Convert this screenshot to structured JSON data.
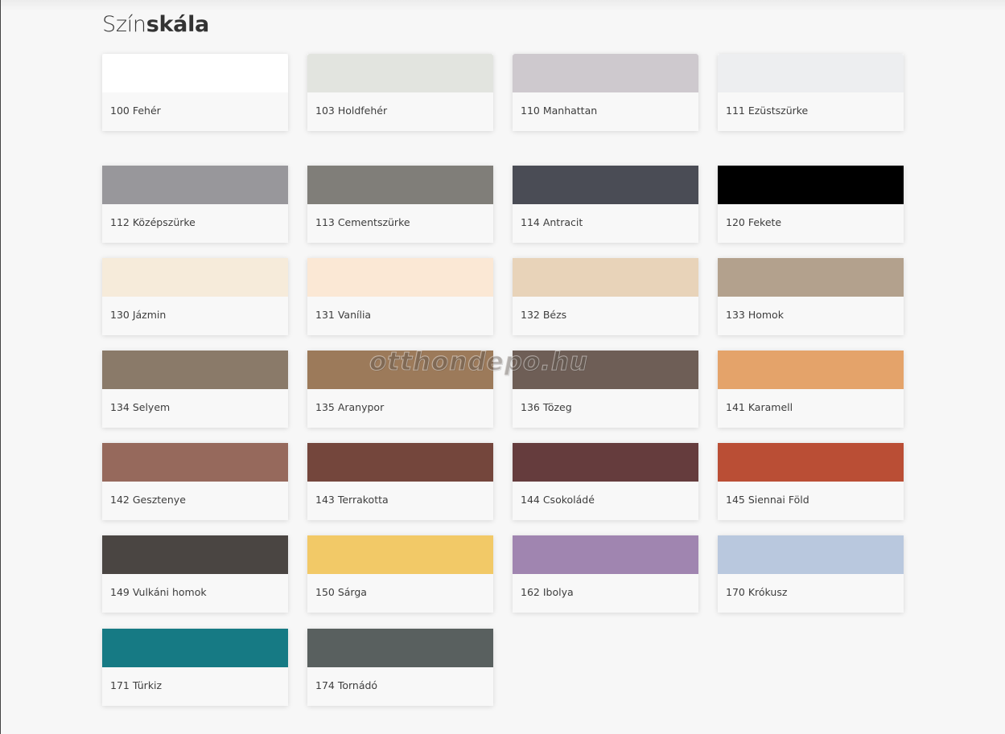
{
  "title": {
    "light": "Szín",
    "bold": "skála"
  },
  "watermark": "otthondepo.hu",
  "swatches": [
    {
      "label": "100 Fehér",
      "color": "#ffffff"
    },
    {
      "label": "103 Holdfehér",
      "color": "#e2e4df"
    },
    {
      "label": "110 Manhattan",
      "color": "#cec9ce"
    },
    {
      "label": "111 Ezüstszürke",
      "color": "#edeef0"
    },
    {
      "label": "112 Középszürke",
      "color": "#98979b"
    },
    {
      "label": "113 Cementszürke",
      "color": "#807e79"
    },
    {
      "label": "114 Antracit",
      "color": "#4a4c55"
    },
    {
      "label": "120 Fekete",
      "color": "#000000"
    },
    {
      "label": "130 Jázmin",
      "color": "#f6ebda"
    },
    {
      "label": "131 Vanília",
      "color": "#fbe8d5"
    },
    {
      "label": "132 Bézs",
      "color": "#e8d3b9"
    },
    {
      "label": "133 Homok",
      "color": "#b3a18d"
    },
    {
      "label": "134 Selyem",
      "color": "#8a7a69"
    },
    {
      "label": "135 Aranypor",
      "color": "#9c7a5a"
    },
    {
      "label": "136 Tözeg",
      "color": "#6e5e56"
    },
    {
      "label": "141 Karamell",
      "color": "#e4a36a"
    },
    {
      "label": "142 Gesztenye",
      "color": "#96695c"
    },
    {
      "label": "143 Terrakotta",
      "color": "#74463c"
    },
    {
      "label": "144 Csokoládé",
      "color": "#653c3d"
    },
    {
      "label": "145 Siennai Föld",
      "color": "#ba4e35"
    },
    {
      "label": "149 Vulkáni homok",
      "color": "#4a4542"
    },
    {
      "label": "150 Sárga",
      "color": "#f2c967"
    },
    {
      "label": "162 Ibolya",
      "color": "#a085b0"
    },
    {
      "label": "170 Krókusz",
      "color": "#b9c8de"
    },
    {
      "label": "171 Türkiz",
      "color": "#167a84"
    },
    {
      "label": "174 Tornádó",
      "color": "#59605f"
    }
  ]
}
